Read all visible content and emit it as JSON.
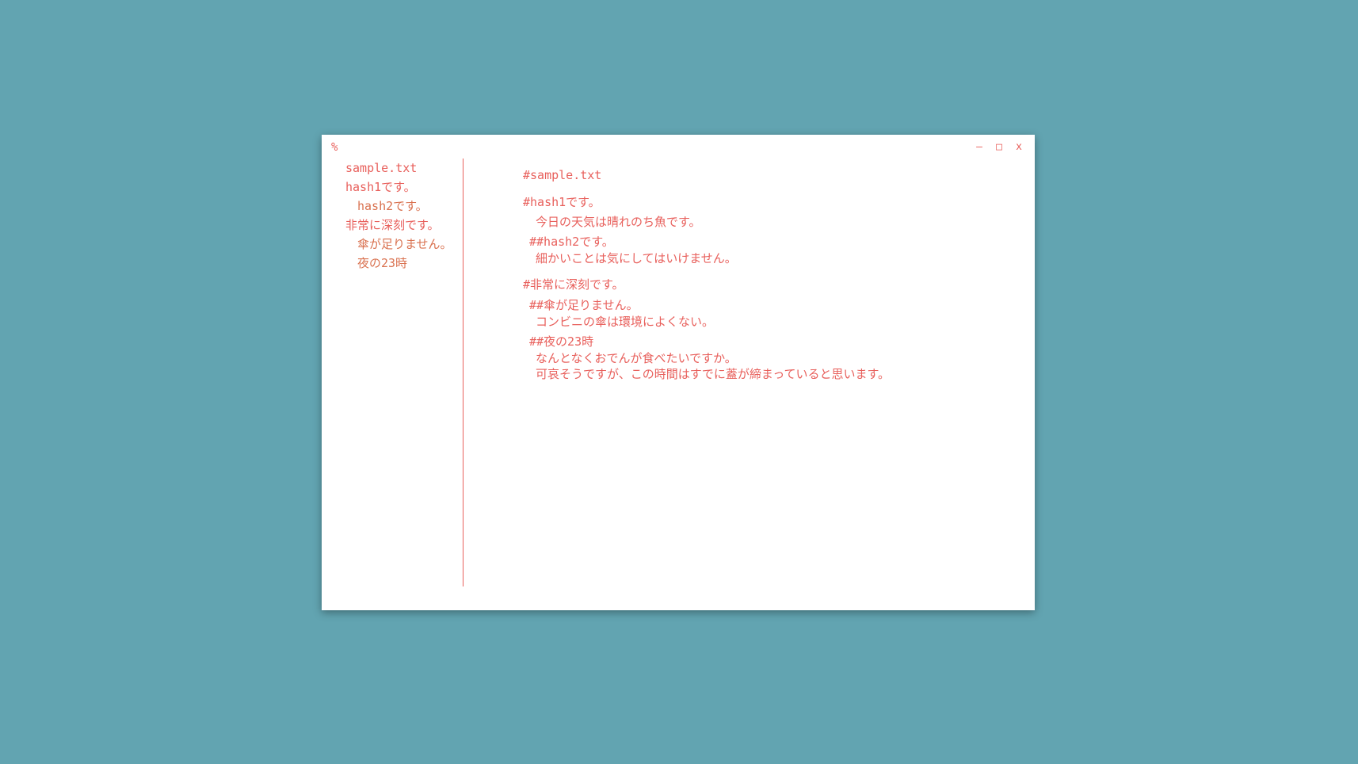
{
  "titlebar": {
    "icon_glyph": "%",
    "minimize_label": "–",
    "maximize_label": "□",
    "close_label": "x"
  },
  "sidebar": {
    "items": [
      {
        "label": "sample.txt",
        "level": 1
      },
      {
        "label": "hash1です。",
        "level": 1
      },
      {
        "label": "hash2です。",
        "level": 2
      },
      {
        "label": "非常に深刻です。",
        "level": 1
      },
      {
        "label": "傘が足りません。",
        "level": 2
      },
      {
        "label": "夜の23時",
        "level": 2
      }
    ]
  },
  "content": {
    "file_heading": "#sample.txt",
    "sections": [
      {
        "heading": "#hash1です。",
        "paragraphs": [
          "今日の天気は晴れのち魚です。"
        ],
        "subsections": [
          {
            "heading": "##hash2です。",
            "paragraphs": [
              "細かいことは気にしてはいけません。"
            ]
          }
        ]
      },
      {
        "heading": "#非常に深刻です。",
        "subsections": [
          {
            "heading": "##傘が足りません。",
            "paragraphs": [
              "コンビニの傘は環境によくない。"
            ]
          },
          {
            "heading": "##夜の23時",
            "paragraphs": [
              "なんとなくおでんが食べたいですか。",
              "可哀そうですが、この時間はすでに蓋が締まっていると思います。"
            ]
          }
        ]
      }
    ]
  },
  "colors": {
    "background": "#62a4b1",
    "window": "#ffffff",
    "accent": "#e8605c",
    "accent_secondary": "#d9714f"
  }
}
